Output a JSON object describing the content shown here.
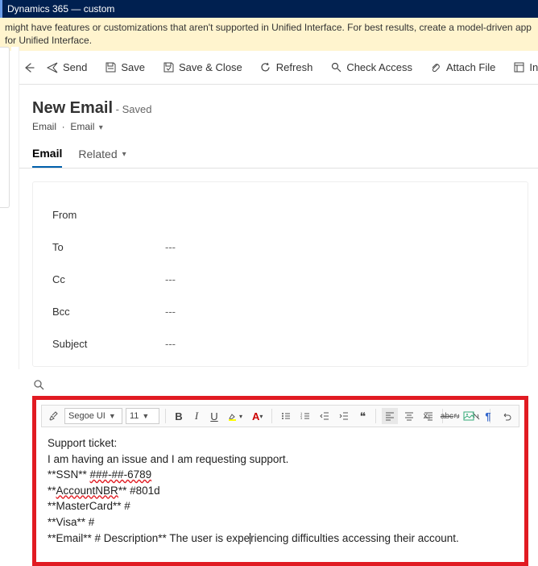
{
  "titlebar": "Dynamics 365 — custom",
  "notice": "might have features or customizations that aren't supported in Unified Interface. For best results, create a model-driven app for Unified Interface.",
  "commands": {
    "send": "Send",
    "save": "Save",
    "saveClose": "Save & Close",
    "refresh": "Refresh",
    "checkAccess": "Check Access",
    "attach": "Attach File",
    "insertTemplate": "Insert Templat"
  },
  "header": {
    "title": "New Email",
    "status": "- Saved",
    "crumb1": "Email",
    "crumb2": "Email"
  },
  "tabs": {
    "email": "Email",
    "related": "Related"
  },
  "form": {
    "from": "From",
    "to": "To",
    "cc": "Cc",
    "bcc": "Bcc",
    "subject": "Subject",
    "empty": "---"
  },
  "editor": {
    "font": "Segoe UI",
    "size": "11",
    "sub": "x",
    "abc": "abc",
    "body": {
      "l1": "Support ticket:",
      "l2": "I am having an issue and I am requesting support.",
      "l3a": "**SSN** ",
      "l3b": "###-##-6789",
      "l4a": "**",
      "l4b": "AccountNBR",
      "l4c": "**  #801d",
      "l5": "**MasterCard** #",
      "l6": "**Visa** #",
      "l7a": "**Email** # Description** The user is expe",
      "l7b": "riencing difficulties accessing their account."
    }
  }
}
